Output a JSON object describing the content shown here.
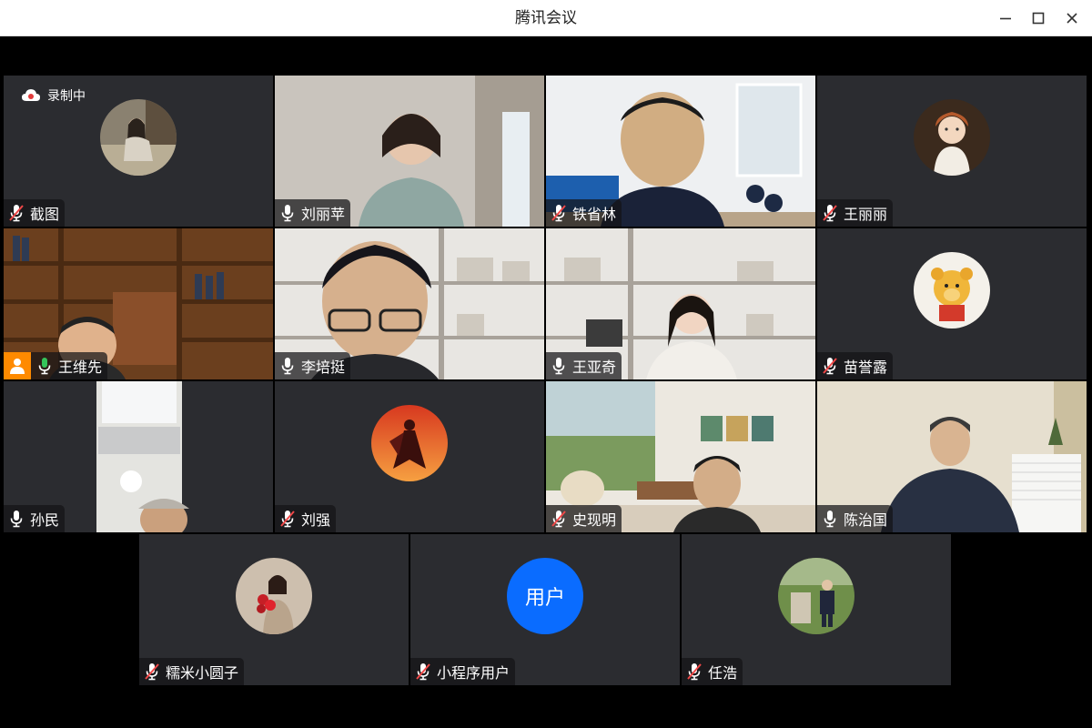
{
  "window": {
    "title": "腾讯会议"
  },
  "recording": {
    "label": "录制中"
  },
  "colors": {
    "tile_bg": "#2b2c30",
    "speaking_green": "#35c45a",
    "host_orange": "#ff8a00",
    "user_blue": "#0a6cff"
  },
  "participants": [
    {
      "name": "截图",
      "mic": "muted",
      "view": "avatar",
      "avatar": "photo-woman-sitting"
    },
    {
      "name": "刘丽苹",
      "mic": "on",
      "view": "video",
      "scene": "woman-curtain-room"
    },
    {
      "name": "铁省林",
      "mic": "muted",
      "view": "video",
      "scene": "man-office-window"
    },
    {
      "name": "王丽丽",
      "mic": "muted",
      "view": "avatar",
      "avatar": "painting-girl"
    },
    {
      "name": "王维先",
      "mic": "speaking",
      "view": "video",
      "scene": "man-bookshelf",
      "host": true
    },
    {
      "name": "李培挺",
      "mic": "on",
      "view": "video",
      "scene": "man-glasses-virtual-shelf"
    },
    {
      "name": "王亚奇",
      "mic": "on",
      "view": "video",
      "scene": "woman-virtual-shelf"
    },
    {
      "name": "苗誉露",
      "mic": "muted",
      "view": "avatar",
      "avatar": "winnie-the-pooh"
    },
    {
      "name": "孙民",
      "mic": "on",
      "view": "video",
      "scene": "man-cap-ceiling"
    },
    {
      "name": "刘强",
      "mic": "muted",
      "view": "avatar",
      "avatar": "red-silhouette"
    },
    {
      "name": "史现明",
      "mic": "muted",
      "view": "video",
      "scene": "man-living-room"
    },
    {
      "name": "陈治国",
      "mic": "on",
      "view": "video",
      "scene": "man-office-paper"
    },
    {
      "name": "糯米小圆子",
      "mic": "muted",
      "view": "avatar",
      "avatar": "woman-red-flowers"
    },
    {
      "name": "小程序用户",
      "mic": "muted",
      "view": "avatar-text",
      "avatar_text": "用户"
    },
    {
      "name": "任浩",
      "mic": "muted",
      "view": "avatar",
      "avatar": "man-garden-photo"
    }
  ]
}
